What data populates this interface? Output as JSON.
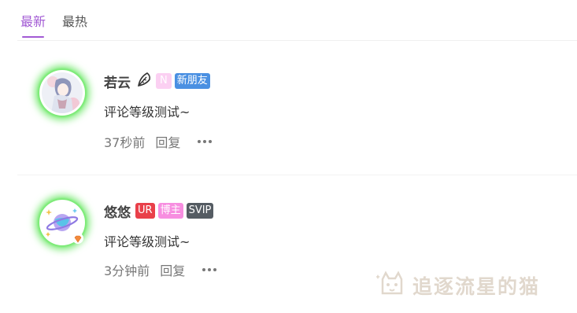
{
  "tabs": {
    "latest": "最新",
    "hot": "最热"
  },
  "comments": [
    {
      "name": "若云",
      "badges": {
        "level": "N",
        "tag": "新朋友"
      },
      "text": "评论等级测试~",
      "time": "37秒前",
      "reply": "回复"
    },
    {
      "name": "悠悠",
      "badges": {
        "level": "UR",
        "tag": "博主",
        "vip": "SVIP"
      },
      "text": "评论等级测试~",
      "time": "3分钟前",
      "reply": "回复"
    }
  ],
  "watermark": "追逐流星的猫",
  "colors": {
    "accent": "#a25ad4",
    "glow": "#6fe86a"
  }
}
